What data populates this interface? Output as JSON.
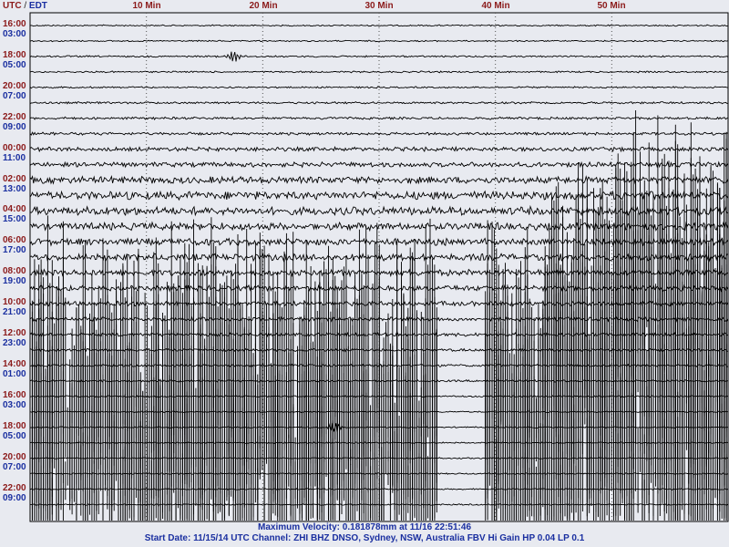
{
  "header": {
    "utc_label": "UTC",
    "separator": "/",
    "local_label": "EDT"
  },
  "minute_labels": [
    "10 Min",
    "20 Min",
    "30 Min",
    "40 Min",
    "50 Min"
  ],
  "footer": {
    "max_velocity": "Maximum Velocity: 0.181878mm at 11/16 22:51:46",
    "start_info": "Start Date: 11/15/14 UTC Channel: ZHI  BHZ  DNSO, Sydney, NSW, Australia  FBV Hi Gain HP 0.04 LP 0.1"
  },
  "colors": {
    "utc_text": "#8b1a1a",
    "local_text": "#1a2fa0",
    "trace": "#000000",
    "grid": "#555555",
    "background": "#e8eaf0"
  },
  "chart_data": {
    "type": "line",
    "description_axis": "helicorder: 32 traces, each 60 minutes",
    "x_unit": "minutes",
    "xlim": [
      0,
      60
    ],
    "x_ticks": [
      10,
      20,
      30,
      40,
      50
    ],
    "grid": "dotted vertical at minute marks",
    "hour_labels": [
      {
        "utc": "16:00",
        "local": "03:00"
      },
      {
        "utc": "18:00",
        "local": "05:00"
      },
      {
        "utc": "20:00",
        "local": "07:00"
      },
      {
        "utc": "22:00",
        "local": "09:00"
      },
      {
        "utc": "00:00",
        "local": "11:00"
      },
      {
        "utc": "02:00",
        "local": "13:00"
      },
      {
        "utc": "04:00",
        "local": "15:00"
      },
      {
        "utc": "06:00",
        "local": "17:00"
      },
      {
        "utc": "08:00",
        "local": "19:00"
      },
      {
        "utc": "10:00",
        "local": "21:00"
      },
      {
        "utc": "12:00",
        "local": "23:00"
      },
      {
        "utc": "14:00",
        "local": "01:00"
      },
      {
        "utc": "16:00",
        "local": "03:00"
      },
      {
        "utc": "18:00",
        "local": "05:00"
      },
      {
        "utc": "20:00",
        "local": "07:00"
      },
      {
        "utc": "22:00",
        "local": "09:00"
      }
    ],
    "trace_count": 32,
    "trace_amplitudes": [
      0.1,
      0.1,
      0.12,
      0.12,
      0.12,
      0.15,
      0.18,
      0.2,
      0.3,
      0.35,
      0.5,
      0.6,
      0.6,
      0.55,
      0.5,
      0.5,
      0.45,
      0.4,
      0.35,
      0.3,
      0.25,
      0.2,
      0.18,
      0.15,
      0.12,
      0.1,
      0.1,
      0.1,
      0.1,
      0.1,
      0.1,
      0.1
    ],
    "saturated_segments": [
      {
        "from_trace": 17,
        "start_min": 50,
        "end_min": 60
      },
      {
        "from_trace": 20,
        "start_min": 44,
        "end_min": 60
      },
      {
        "from_trace": 24,
        "start_min": 0,
        "end_min": 35
      },
      {
        "from_trace": 24,
        "start_min": 39,
        "end_min": 60
      }
    ],
    "events": [
      {
        "trace": 2,
        "minute": 17.5,
        "amp": 0.6
      },
      {
        "trace": 26,
        "minute": 26.2,
        "amp": 0.6
      }
    ]
  }
}
